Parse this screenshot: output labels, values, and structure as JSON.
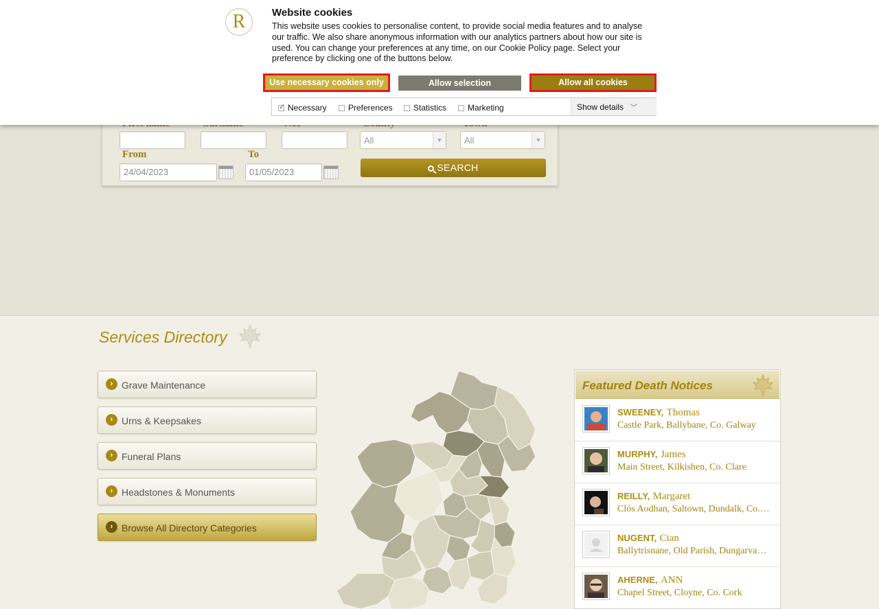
{
  "cookie_banner": {
    "logo_letter": "R",
    "title": "Website cookies",
    "body": "This website uses cookies to personalise content, to provide social media features and to analyse our traffic. We also share anonymous information with our analytics partners about how our site is used. You can change your preferences at any time, on our Cookie Policy page. Select your preference by clicking one of the buttons below.",
    "btn_necessary": "Use necessary cookies only",
    "btn_selection": "Allow selection",
    "btn_all": "Allow all cookies",
    "options": [
      {
        "label": "Necessary",
        "checked": true
      },
      {
        "label": "Preferences",
        "checked": false
      },
      {
        "label": "Statistics",
        "checked": false
      },
      {
        "label": "Marketing",
        "checked": false
      }
    ],
    "show_details": "Show details"
  },
  "search": {
    "labels": {
      "first_name": "First name",
      "surname": "Surname",
      "nee": "Nee",
      "county": "County",
      "town": "Town",
      "from": "From",
      "to": "To"
    },
    "county_value": "All",
    "town_value": "All",
    "from_value": "24/04/2023",
    "to_value": "01/05/2023",
    "button": "SEARCH"
  },
  "directory": {
    "title": "Services Directory",
    "items": [
      "Grave Maintenance",
      "Urns & Keepsakes",
      "Funeral Plans",
      "Headstones & Monuments",
      "Browse All Directory Categories"
    ]
  },
  "featured": {
    "title": "Featured Death Notices",
    "notices": [
      {
        "surname": "SWEENEY,",
        "forename": "Thomas",
        "address": "Castle Park, Ballybane, Co. Galway"
      },
      {
        "surname": "MURPHY,",
        "forename": "James",
        "address": "Main Street, Kilkishen, Co. Clare"
      },
      {
        "surname": "REILLY,",
        "forename": "Margaret",
        "address": "Clós Aodhan, Saltown, Dundalk, Co. Louth"
      },
      {
        "surname": "NUGENT,",
        "forename": "Cian",
        "address": "Ballytrisnane, Old Parish, Dungarvan, Co. Waterford"
      },
      {
        "surname": "AHERNE,",
        "forename": "ANN",
        "address": "Chapel Street, Cloyne, Co. Cork"
      }
    ]
  },
  "colors": {
    "gold": "#ad8d12",
    "accent_red": "#e41a1a",
    "button_grey": "#7b7b6e",
    "button_gold": "#9a7e12"
  }
}
